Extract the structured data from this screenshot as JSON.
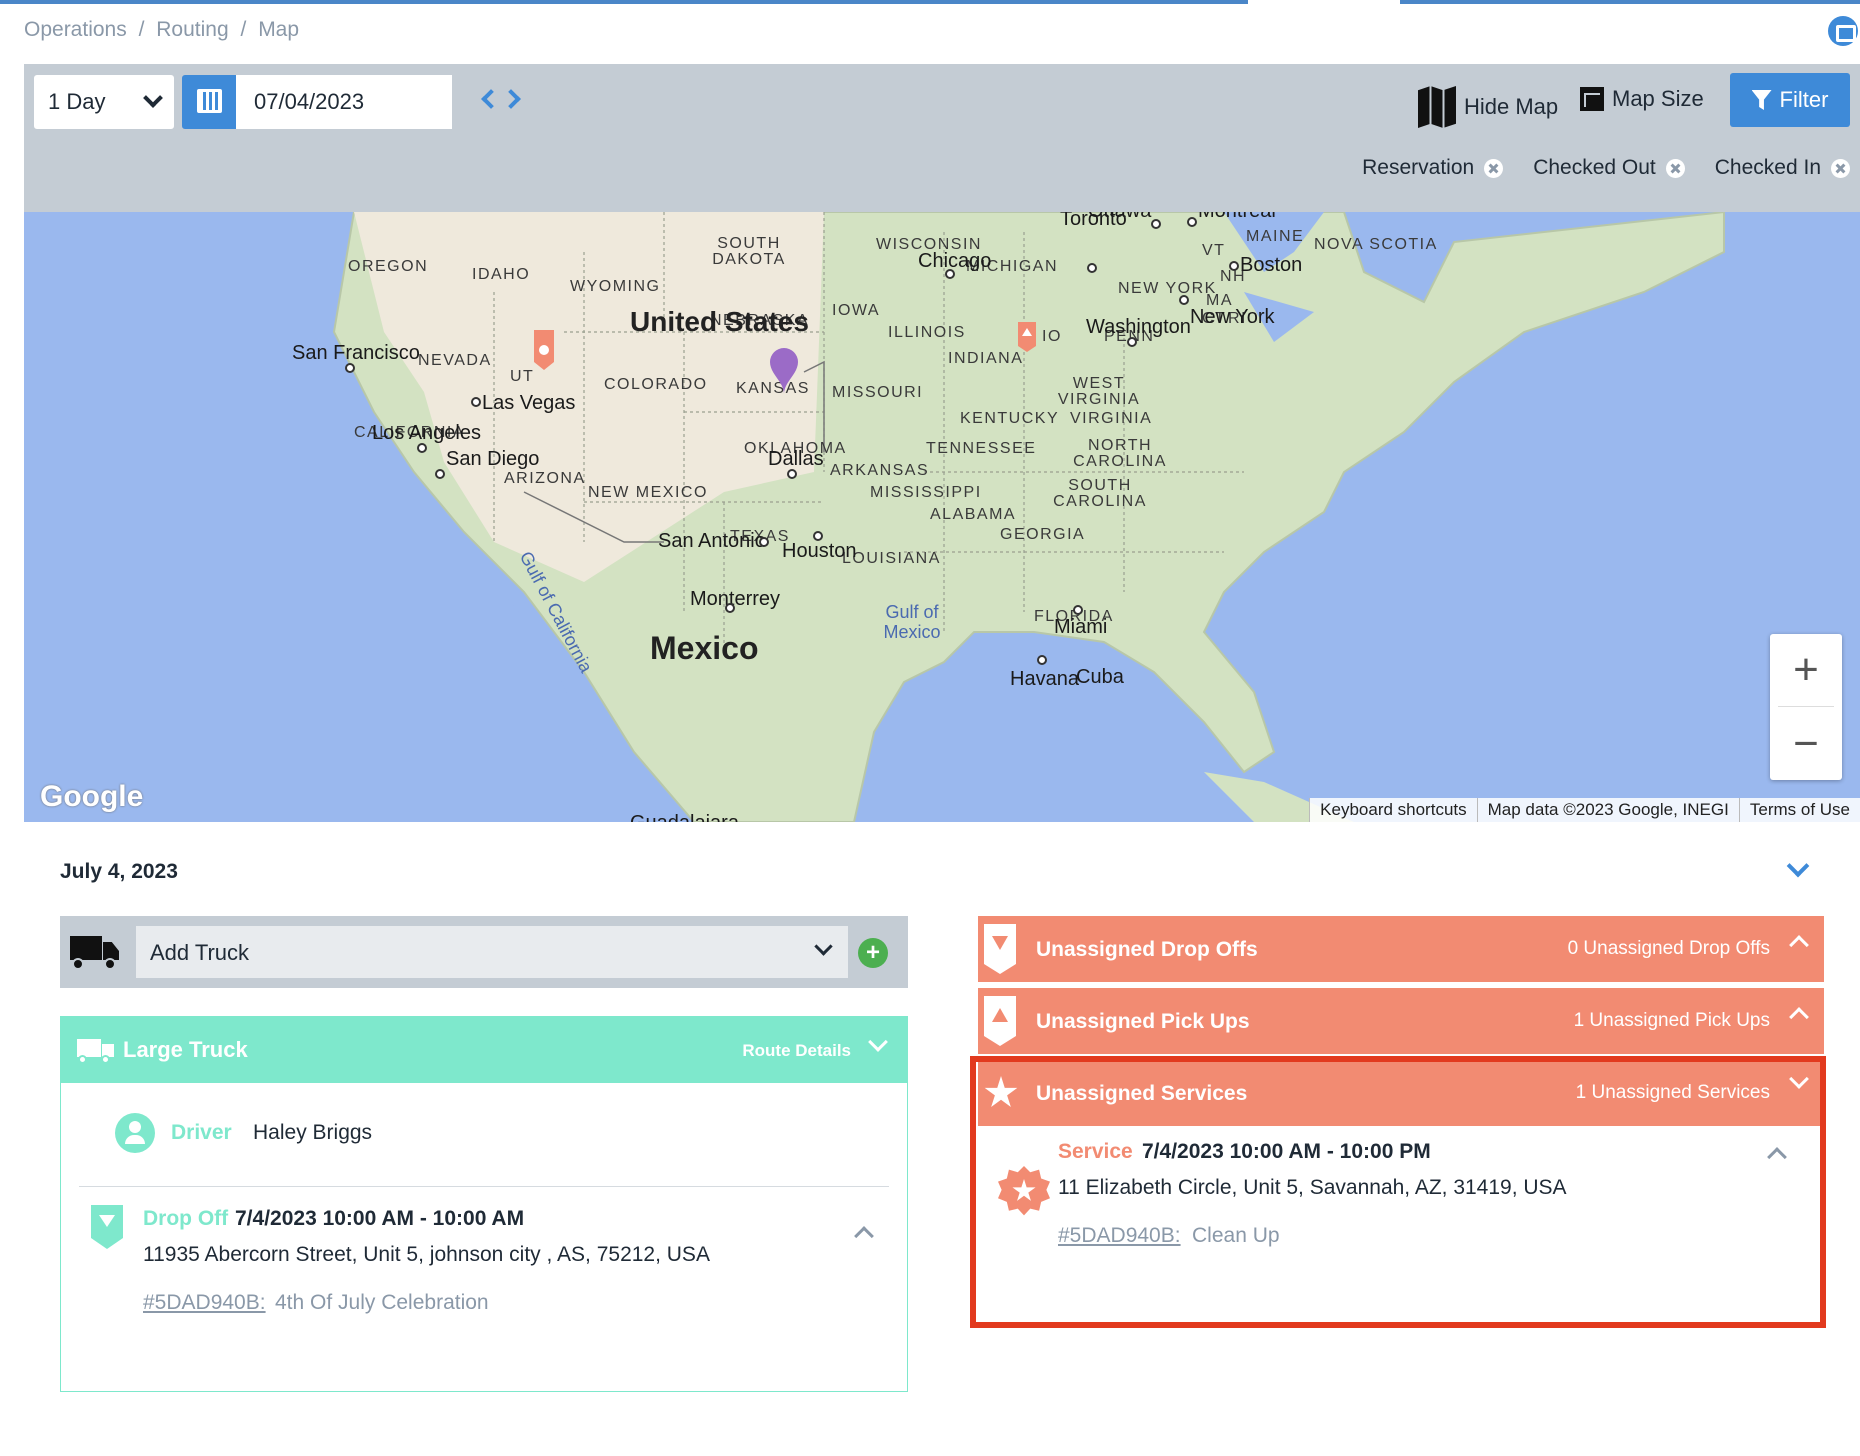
{
  "breadcrumb": [
    "Operations",
    "/",
    "Routing",
    "/",
    "Map"
  ],
  "toolbar": {
    "range_select": "1 Day",
    "date_value": "07/04/2023",
    "hide_map_label": "Hide Map",
    "map_size_label": "Map Size",
    "filter_label": "Filter"
  },
  "filters": [
    {
      "label": "Reservation"
    },
    {
      "label": "Checked Out"
    },
    {
      "label": "Checked In"
    }
  ],
  "map": {
    "states": [
      "OREGON",
      "IDAHO",
      "WYOMING",
      "SOUTH DAKOTA",
      "NEBRASKA",
      "NEVADA",
      "UT",
      "COLORADO",
      "KANSAS",
      "CALIFORNIA",
      "ARIZONA",
      "NEW MEXICO",
      "OKLAHOMA",
      "TEXAS",
      "WISCONSIN",
      "MICHIGAN",
      "IOWA",
      "ILLINOIS",
      "INDIANA",
      "MISSOURI",
      "KENTUCKY",
      "TENNESSEE",
      "ARKANSAS",
      "MISSISSIPPI",
      "ALABAMA",
      "GEORGIA",
      "LOUISIANA",
      "FLORIDA",
      "WEST VIRGINIA",
      "VIRGINIA",
      "NORTH CAROLINA",
      "SOUTH CAROLINA",
      "PENN",
      "NEW YORK",
      "VT",
      "NH",
      "MA",
      "CT",
      "RI",
      "MAINE",
      "NOVA SCOTIA",
      "IO"
    ],
    "cities": [
      "San Francisco",
      "Las Vegas",
      "Los Angeles",
      "San Diego",
      "Dallas",
      "San Antonio",
      "Houston",
      "Monterrey",
      "Chicago",
      "Toronto",
      "Boston",
      "New York",
      "Washington",
      "Miami",
      "Havana",
      "Ottawa",
      "Montreal",
      "Guadalajara",
      "Cuba"
    ],
    "country_us": "United States",
    "country_mx": "Mexico",
    "water_gulf_mexico": "Gulf of Mexico",
    "water_gulf_ca": "Gulf of California",
    "google_logo": "Google",
    "footer": [
      "Keyboard shortcuts",
      "Map data ©2023 Google, INEGI",
      "Terms of Use"
    ],
    "zoom_in": "+",
    "zoom_out": "−"
  },
  "day": {
    "title": "July 4, 2023"
  },
  "truck_select": {
    "placeholder": "Add Truck",
    "add_symbol": "+"
  },
  "route": {
    "title": "Large Truck",
    "details_label": "Route Details",
    "driver_label": "Driver",
    "driver_name": "Haley Briggs",
    "stop": {
      "type": "Drop Off",
      "time": "7/4/2023  10:00 AM - 10:00 AM",
      "address": "11935 Abercorn Street, Unit 5, johnson city , AS, 75212, USA",
      "link": "#5DAD940B:",
      "description": "4th Of July Celebration"
    }
  },
  "unassigned": {
    "drop_offs": {
      "title": "Unassigned Drop Offs",
      "count": "0 Unassigned Drop Offs"
    },
    "pick_ups": {
      "title": "Unassigned Pick Ups",
      "count": "1 Unassigned Pick Ups"
    },
    "services": {
      "title": "Unassigned Services",
      "count": "1 Unassigned Services",
      "item": {
        "type": "Service",
        "time": "7/4/2023  10:00 AM - 10:00 PM",
        "address": "11 Elizabeth Circle, Unit 5, Savannah, AZ, 31419, USA",
        "link": "#5DAD940B:",
        "description": "Clean Up"
      }
    }
  },
  "colors": {
    "primary": "#3e8ad8",
    "teal": "#7ee8cc",
    "salmon": "#f28b72",
    "highlight": "#e23a1e",
    "toolbar_bg": "#c4ccd4"
  }
}
